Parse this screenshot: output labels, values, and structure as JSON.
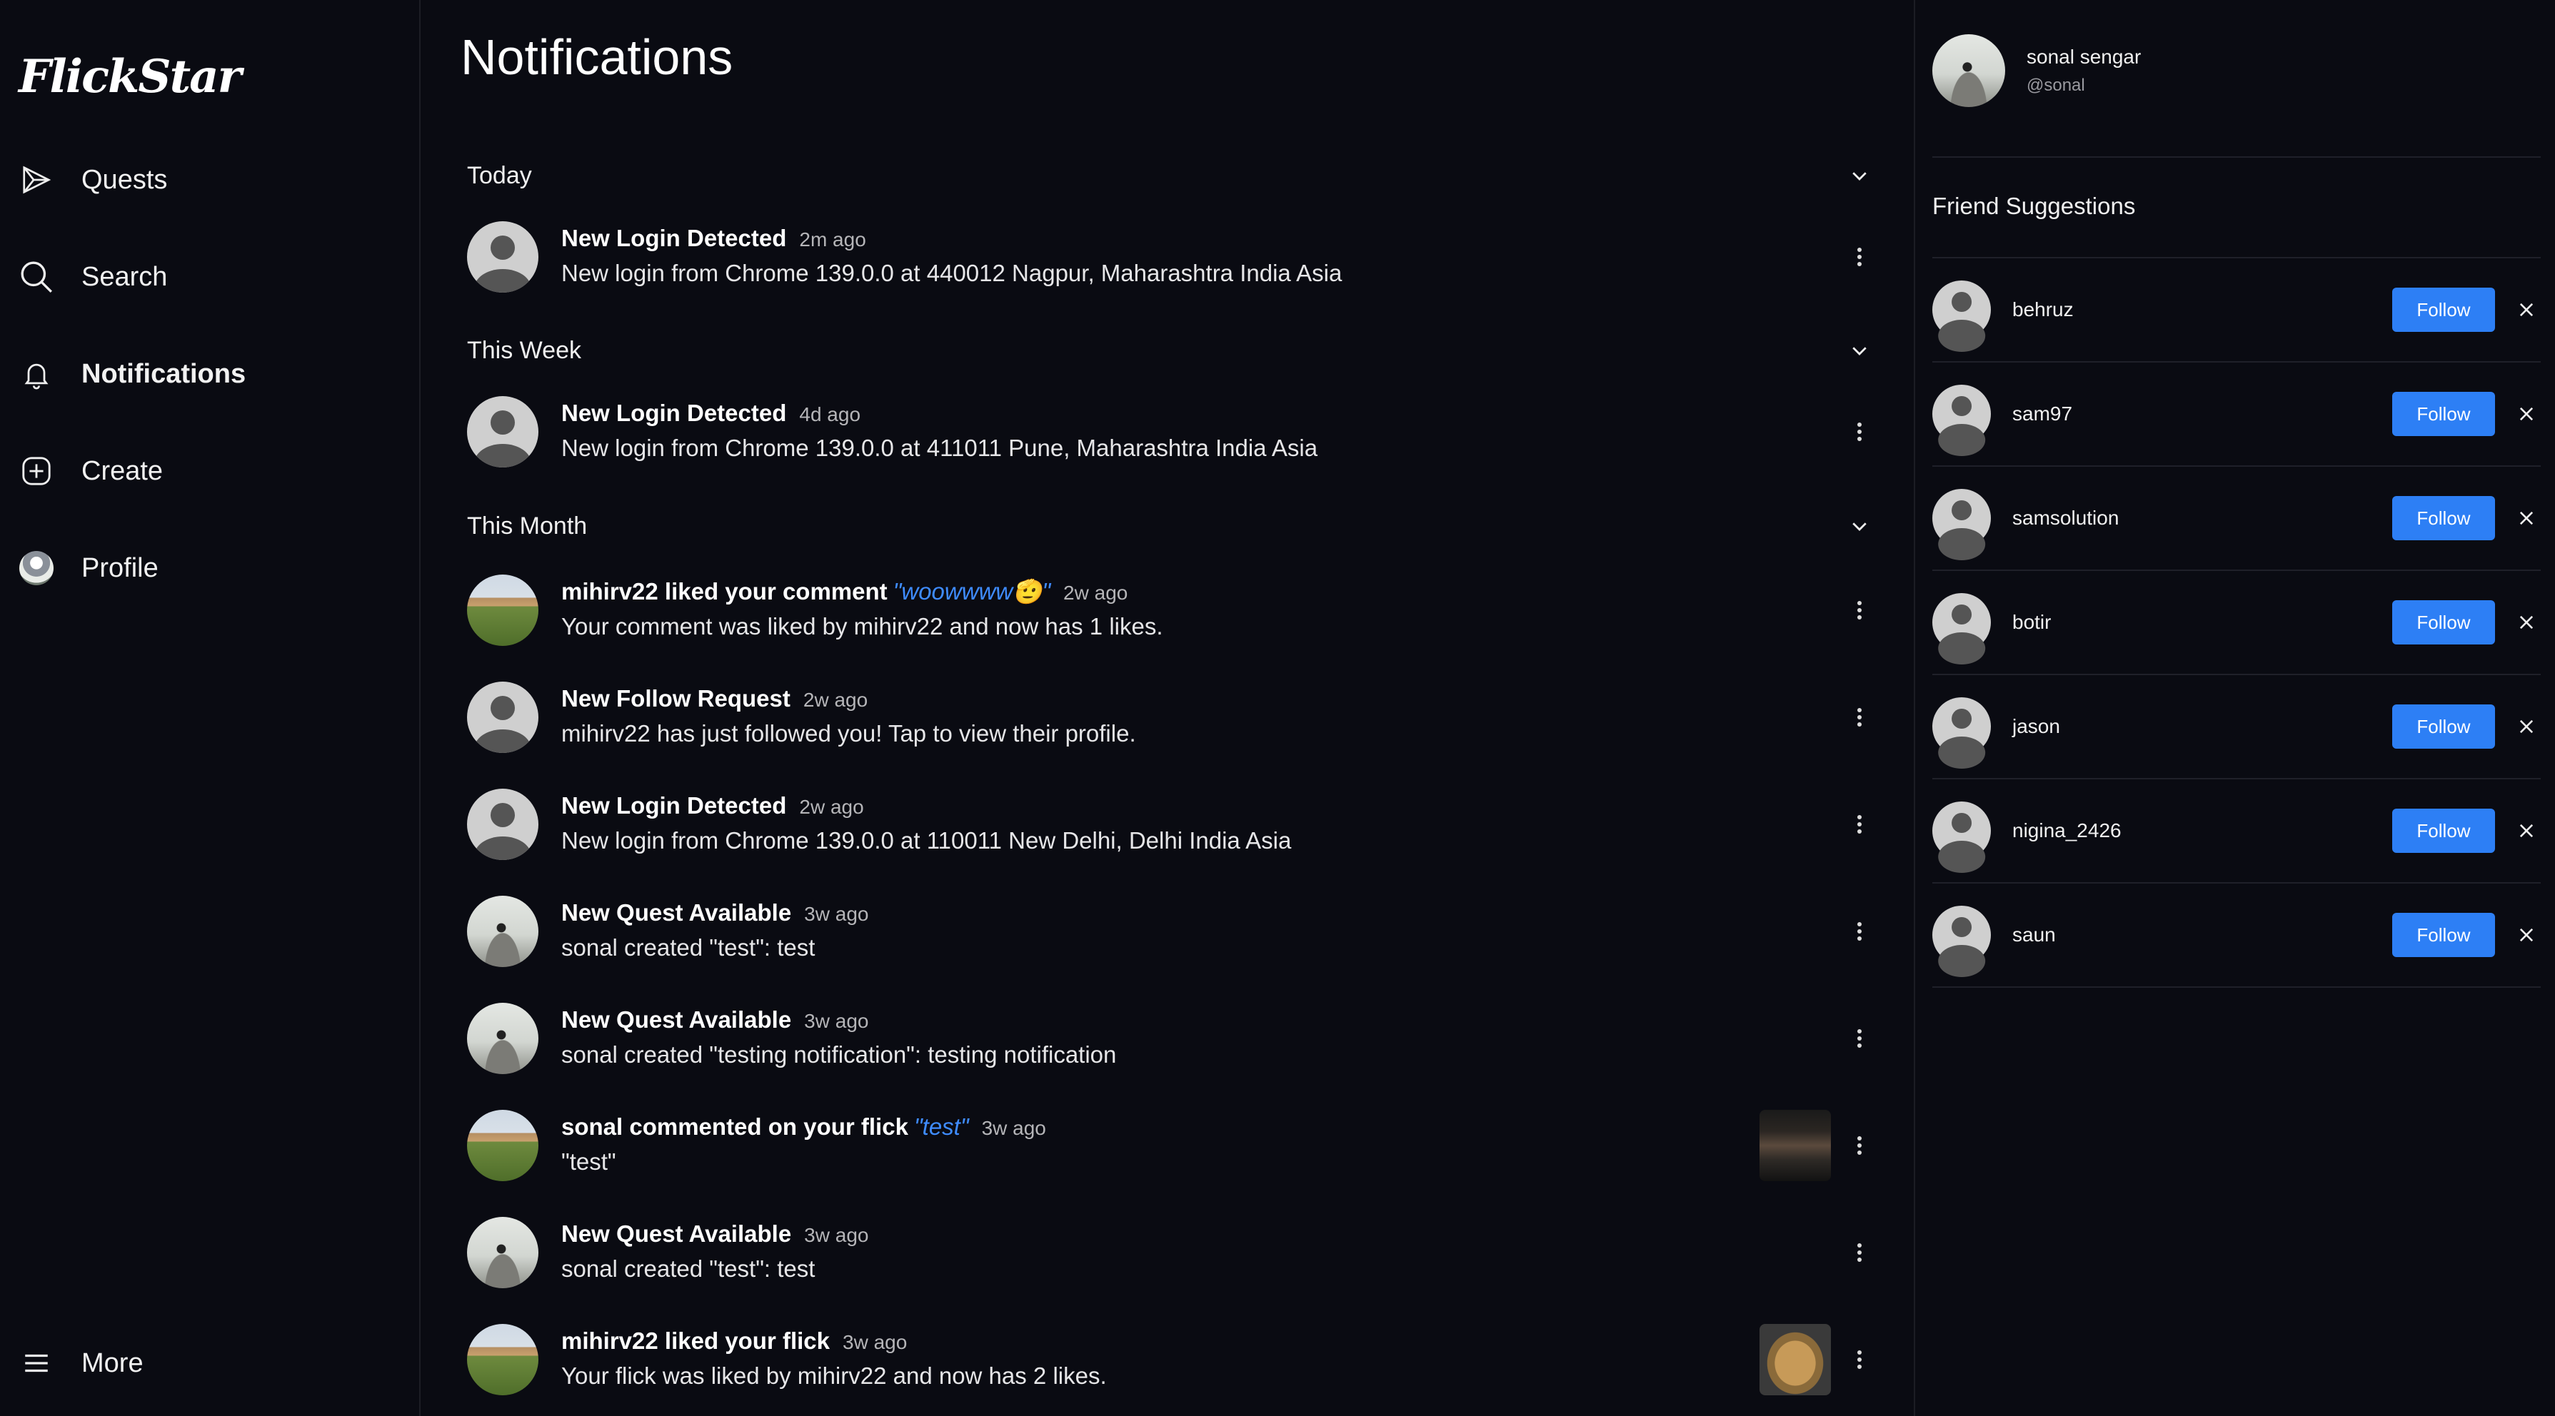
{
  "app": {
    "logo": "FlickStar"
  },
  "sidebar": {
    "items": [
      {
        "label": "Quests",
        "icon": "paper-plane-icon"
      },
      {
        "label": "Search",
        "icon": "search-icon"
      },
      {
        "label": "Notifications",
        "icon": "bell-icon",
        "active": true
      },
      {
        "label": "Create",
        "icon": "plus-square-icon"
      },
      {
        "label": "Profile",
        "icon": "avatar"
      }
    ],
    "more": {
      "label": "More",
      "icon": "menu-icon"
    }
  },
  "main": {
    "title": "Notifications",
    "sections": [
      {
        "title": "Today"
      },
      {
        "title": "This Week"
      },
      {
        "title": "This Month"
      }
    ],
    "notifications": [
      {
        "heading": "New Login Detected",
        "quote": "",
        "time": "2m ago",
        "text": "New login from Chrome 139.0.0 at 440012 Nagpur, Maharashtra India Asia",
        "avatar": "default",
        "thumb": ""
      },
      {
        "heading": "New Login Detected",
        "quote": "",
        "time": "4d ago",
        "text": "New login from Chrome 139.0.0 at 411011 Pune, Maharashtra India Asia",
        "avatar": "default",
        "thumb": ""
      },
      {
        "heading": "mihirv22 liked your comment",
        "quote": "\"woowwww🫡\"",
        "time": "2w ago",
        "text": "Your comment was liked by mihirv22 and now has 1 likes.",
        "avatar": "palace",
        "thumb": ""
      },
      {
        "heading": "New Follow Request",
        "quote": "",
        "time": "2w ago",
        "text": "mihirv22 has just followed you! Tap to view their profile.",
        "avatar": "default",
        "thumb": ""
      },
      {
        "heading": "New Login Detected",
        "quote": "",
        "time": "2w ago",
        "text": "New login from Chrome 139.0.0 at 110011 New Delhi, Delhi India Asia",
        "avatar": "default",
        "thumb": ""
      },
      {
        "heading": "New Quest Available",
        "quote": "",
        "time": "3w ago",
        "text": "sonal created \"test\": test",
        "avatar": "rock",
        "thumb": ""
      },
      {
        "heading": "New Quest Available",
        "quote": "",
        "time": "3w ago",
        "text": "sonal created \"testing notification\": testing notification",
        "avatar": "rock",
        "thumb": ""
      },
      {
        "heading": "sonal commented on your flick",
        "quote": "\"test\"",
        "time": "3w ago",
        "text": "\"test\"",
        "avatar": "palace",
        "thumb": "tv"
      },
      {
        "heading": "New Quest Available",
        "quote": "",
        "time": "3w ago",
        "text": "sonal created \"test\": test",
        "avatar": "rock",
        "thumb": ""
      },
      {
        "heading": "mihirv22 liked your flick",
        "quote": "",
        "time": "3w ago",
        "text": "Your flick was liked by mihirv22 and now has 2 likes.",
        "avatar": "palace",
        "thumb": "dog"
      }
    ]
  },
  "right": {
    "me": {
      "full_name": "sonal sengar",
      "handle": "@sonal"
    },
    "suggestions_title": "Friend Suggestions",
    "follow_label": "Follow",
    "suggestions": [
      "behruz",
      "sam97",
      "samsolution",
      "botir",
      "jason",
      "nigina_2426",
      "saun"
    ]
  },
  "colors": {
    "background": "#0a0b12",
    "accent": "#2d7ff5",
    "quote": "#3f8cff"
  }
}
